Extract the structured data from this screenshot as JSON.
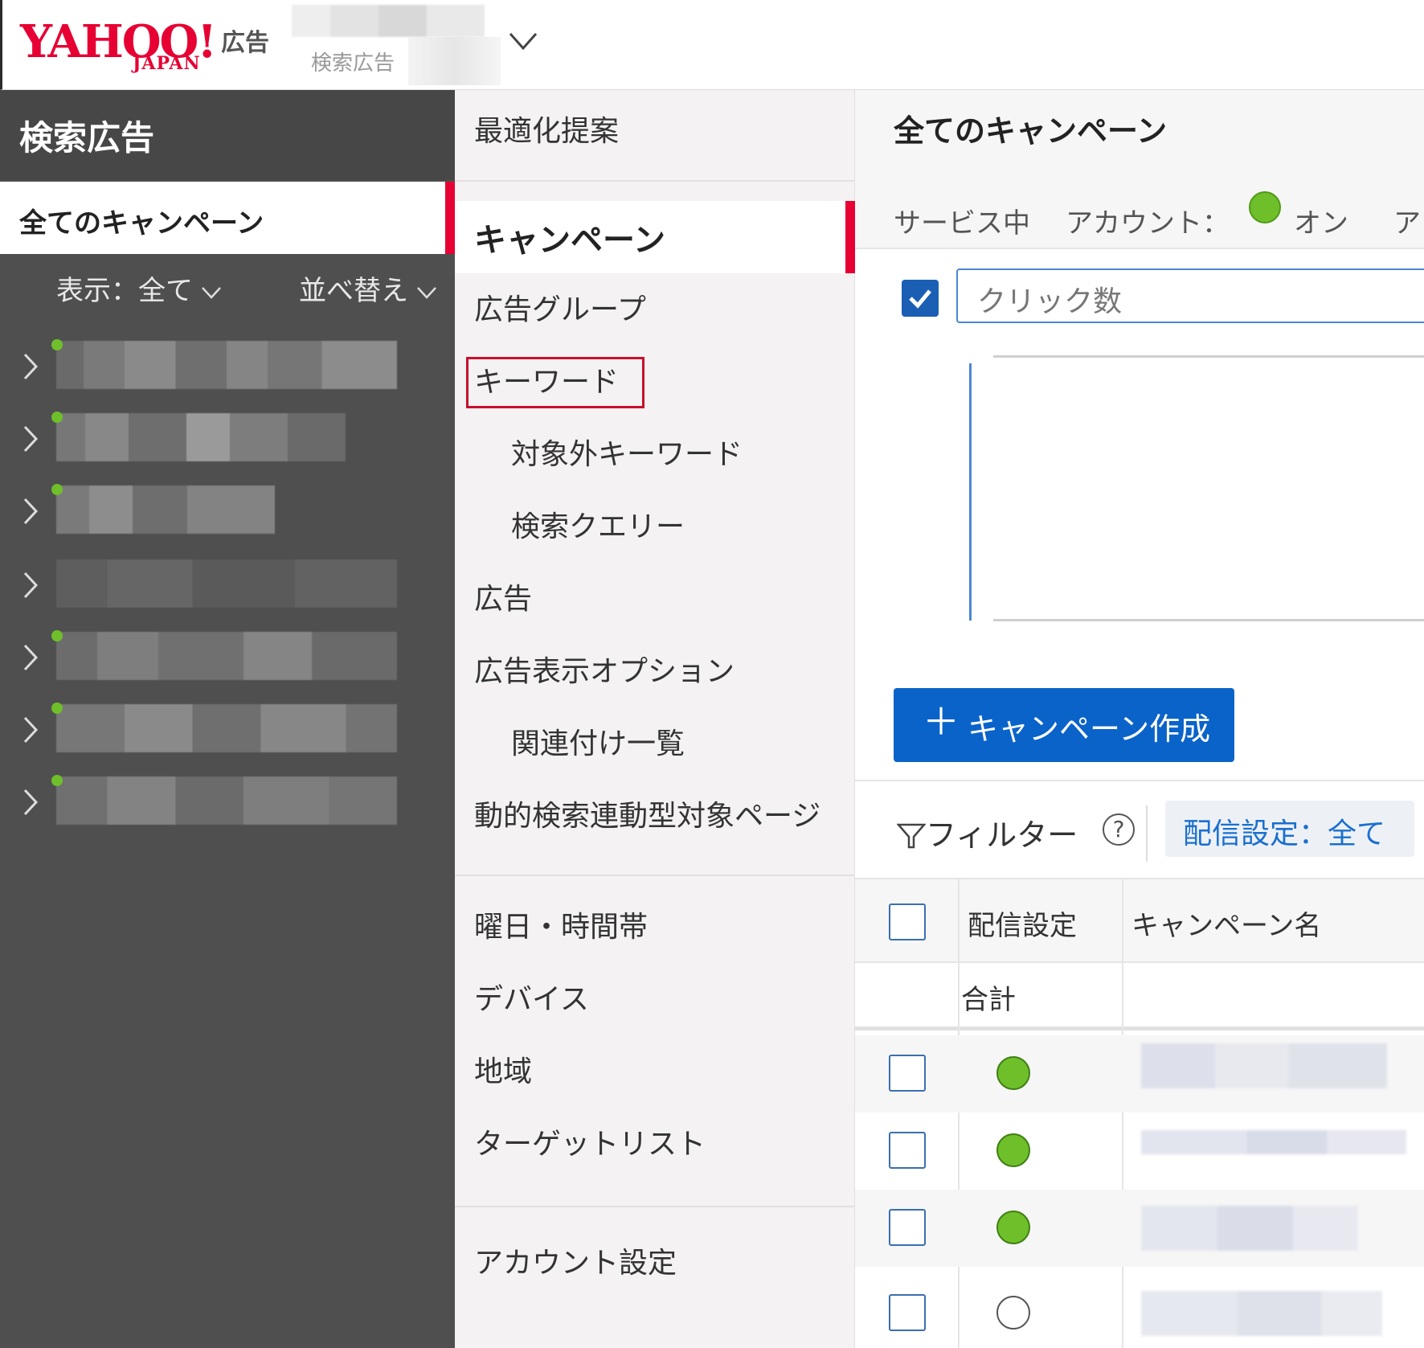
{
  "header": {
    "logo_yahoo": "YAHOO!",
    "logo_japan": "JAPAN",
    "logo_ad": "広告",
    "account_type": "検索広告"
  },
  "sidebar": {
    "title": "検索広告",
    "selected": "全てのキャンペーン",
    "display_filter": "表示：全て",
    "sort": "並べ替え",
    "campaign_count": 7
  },
  "menu": {
    "optimization": "最適化提案",
    "campaign": "キャンペーン",
    "ad_group": "広告グループ",
    "keyword": "キーワード",
    "negative_keyword": "対象外キーワード",
    "search_query": "検索クエリー",
    "ad": "広告",
    "ad_extensions": "広告表示オプション",
    "associations": "関連付け一覧",
    "dsa_target": "動的検索連動型対象ページ",
    "schedule": "曜日・時間帯",
    "device": "デバイス",
    "region": "地域",
    "target_list": "ターゲットリスト",
    "account_settings": "アカウント設定"
  },
  "main": {
    "title": "全てのキャンペーン",
    "service_status": "サービス中",
    "account_label": "アカウント：",
    "account_status": "オン",
    "account_truncated": "ア",
    "metric": "クリック数",
    "create_button": "キャンペーン作成",
    "filter_label": "フィルター",
    "help": "?",
    "filter_chip": "配信設定：全て",
    "columns": {
      "delivery": "配信設定",
      "campaign_name": "キャンペーン名"
    },
    "total_label": "合計",
    "rows": [
      {
        "status": "on"
      },
      {
        "status": "on"
      },
      {
        "status": "on"
      },
      {
        "status": "off"
      }
    ]
  },
  "colors": {
    "brand_red": "#e60033",
    "primary_blue": "#0a63c9",
    "status_green": "#6fbf2a",
    "sidebar_bg": "#4f4f4f"
  }
}
